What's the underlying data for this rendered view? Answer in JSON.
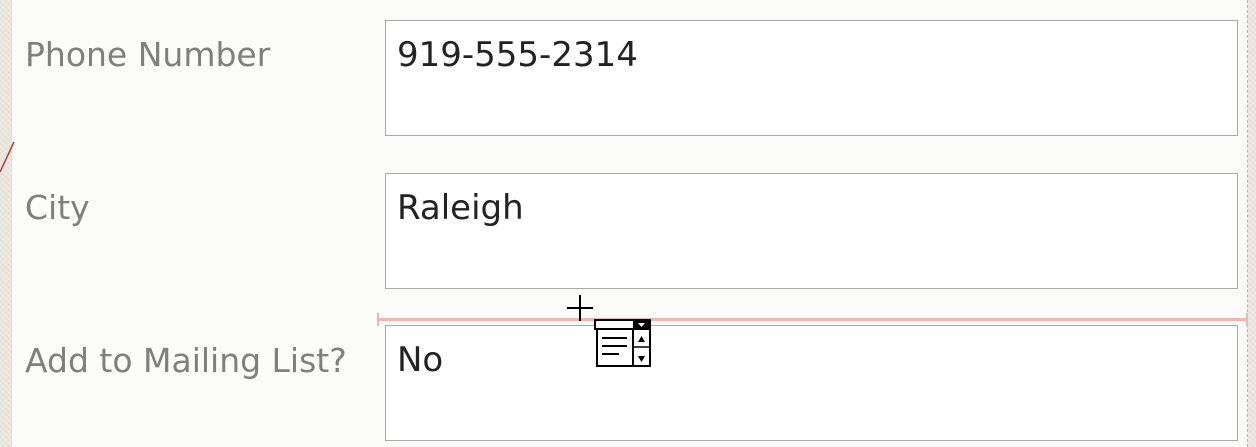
{
  "form": {
    "fields": [
      {
        "label": "Phone Number",
        "value": "919-555-2314"
      },
      {
        "label": "City",
        "value": "Raleigh"
      },
      {
        "label": "Add to Mailing List?",
        "value": "No"
      }
    ]
  },
  "cursor": {
    "icons": [
      "crosshair-icon",
      "combo-box-drag-icon"
    ]
  },
  "colors": {
    "label": "#7f7f7f",
    "value": "#222222",
    "box_border": "#a9a9a9",
    "insertion_line": "#f2b3b3"
  }
}
